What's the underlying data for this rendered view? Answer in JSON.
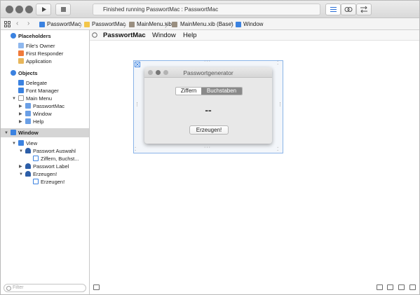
{
  "toolbar": {
    "status": "Finished running PasswortMac : PasswortMac"
  },
  "jumpbar": {
    "crumbs": [
      "PasswortMac",
      "PasswortMac",
      "MainMenu.xib",
      "MainMenu.xib (Base)",
      "Window"
    ]
  },
  "outline": {
    "placeholders": "Placeholders",
    "files_owner": "File's Owner",
    "first_responder": "First Responder",
    "application": "Application",
    "objects": "Objects",
    "delegate": "Delegate",
    "font_manager": "Font Manager",
    "main_menu": "Main Menu",
    "menu_passwortmac": "PasswortMac",
    "menu_window": "Window",
    "menu_help": "Help",
    "window": "Window",
    "view": "View",
    "passwort_auswahl": "Passwort Auswahl",
    "ziffern_buchst": "Ziffern, Buchst...",
    "passwort_label": "Passwort Label",
    "erzeugen_parent": "Erzeugen!",
    "erzeugen_child": "Erzeugen!",
    "filter_placeholder": "Filter"
  },
  "canvas": {
    "menu": [
      "PasswortMac",
      "Window",
      "Help"
    ],
    "dialog": {
      "title": "Passwortgenerator",
      "segment_left": "Ziffern",
      "segment_right": "Buchstaben",
      "password": "--",
      "button": "Erzeugen!"
    }
  },
  "colors": {
    "accent": "#3478d9",
    "selection_row": "#d5d5d5"
  }
}
